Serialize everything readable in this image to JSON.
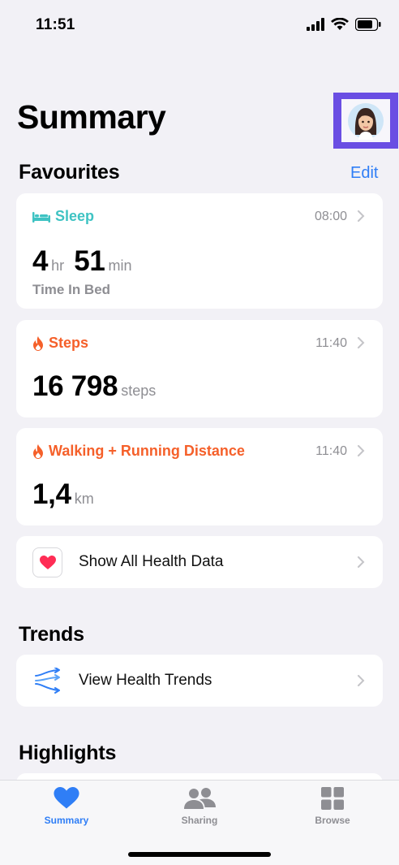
{
  "status": {
    "time": "11:51"
  },
  "header": {
    "title": "Summary"
  },
  "favourites": {
    "title": "Favourites",
    "edit_label": "Edit",
    "sleep": {
      "label": "Sleep",
      "time": "08:00",
      "hours": "4",
      "hours_unit": "hr",
      "minutes": "51",
      "minutes_unit": "min",
      "sub": "Time In Bed",
      "color": "#3fc3c3"
    },
    "steps": {
      "label": "Steps",
      "time": "11:40",
      "value": "16 798",
      "unit": "steps",
      "color": "#f5602a"
    },
    "distance": {
      "label": "Walking + Running Distance",
      "time": "11:40",
      "value": "1,4",
      "unit": "km",
      "color": "#f5602a"
    },
    "show_all_label": "Show All Health Data"
  },
  "trends": {
    "title": "Trends",
    "view_label": "View Health Trends"
  },
  "highlights": {
    "title": "Highlights"
  },
  "tabs": [
    {
      "label": "Summary",
      "icon": "heart-icon",
      "active": true
    },
    {
      "label": "Sharing",
      "icon": "people-icon",
      "active": false
    },
    {
      "label": "Browse",
      "icon": "grid-icon",
      "active": false
    }
  ],
  "colors": {
    "accent": "#2f7ef6",
    "inactive": "#8e8e93",
    "highlight_box": "#6a4ee3"
  }
}
